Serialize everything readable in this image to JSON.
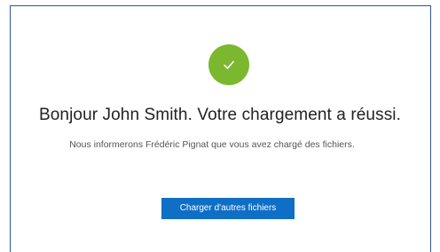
{
  "status": {
    "icon": "checkmark-icon",
    "color": "#7cb82f"
  },
  "message": {
    "headline": "Bonjour John Smith. Votre chargement a réussi.",
    "detail": "Nous informerons Frédéric Pignat que vous avez chargé des fichiers."
  },
  "actions": {
    "upload_more_label": "Charger d'autres fichiers",
    "accent_color": "#0f6fc6"
  }
}
